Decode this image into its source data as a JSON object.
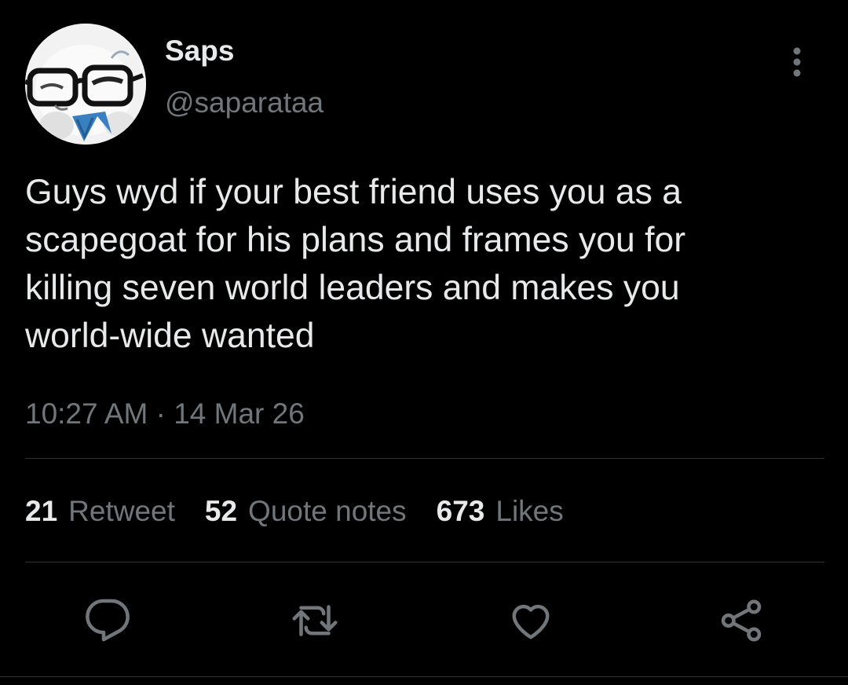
{
  "author": {
    "display_name": "Saps",
    "handle": "@saparataa",
    "avatar_icon": "avatar-image"
  },
  "tweet": {
    "text": "Guys wyd if your best friend uses you as a\nscapegoat for his plans and frames you for\nkilling seven world leaders and makes you\nworld-wide wanted",
    "timestamp": "10:27 AM · 14 Mar 26"
  },
  "stats": [
    {
      "count": "21",
      "label": "Retweet"
    },
    {
      "count": "52",
      "label": "Quote notes"
    },
    {
      "count": "673",
      "label": "Likes"
    }
  ],
  "actions": [
    {
      "name": "reply",
      "icon": "reply-icon"
    },
    {
      "name": "retweet",
      "icon": "retweet-icon"
    },
    {
      "name": "like",
      "icon": "heart-icon"
    },
    {
      "name": "share",
      "icon": "share-icon"
    }
  ],
  "colors": {
    "background": "#000000",
    "primary_text": "#e7e9ea",
    "secondary_text": "#71767b",
    "divider": "#2f3336"
  }
}
